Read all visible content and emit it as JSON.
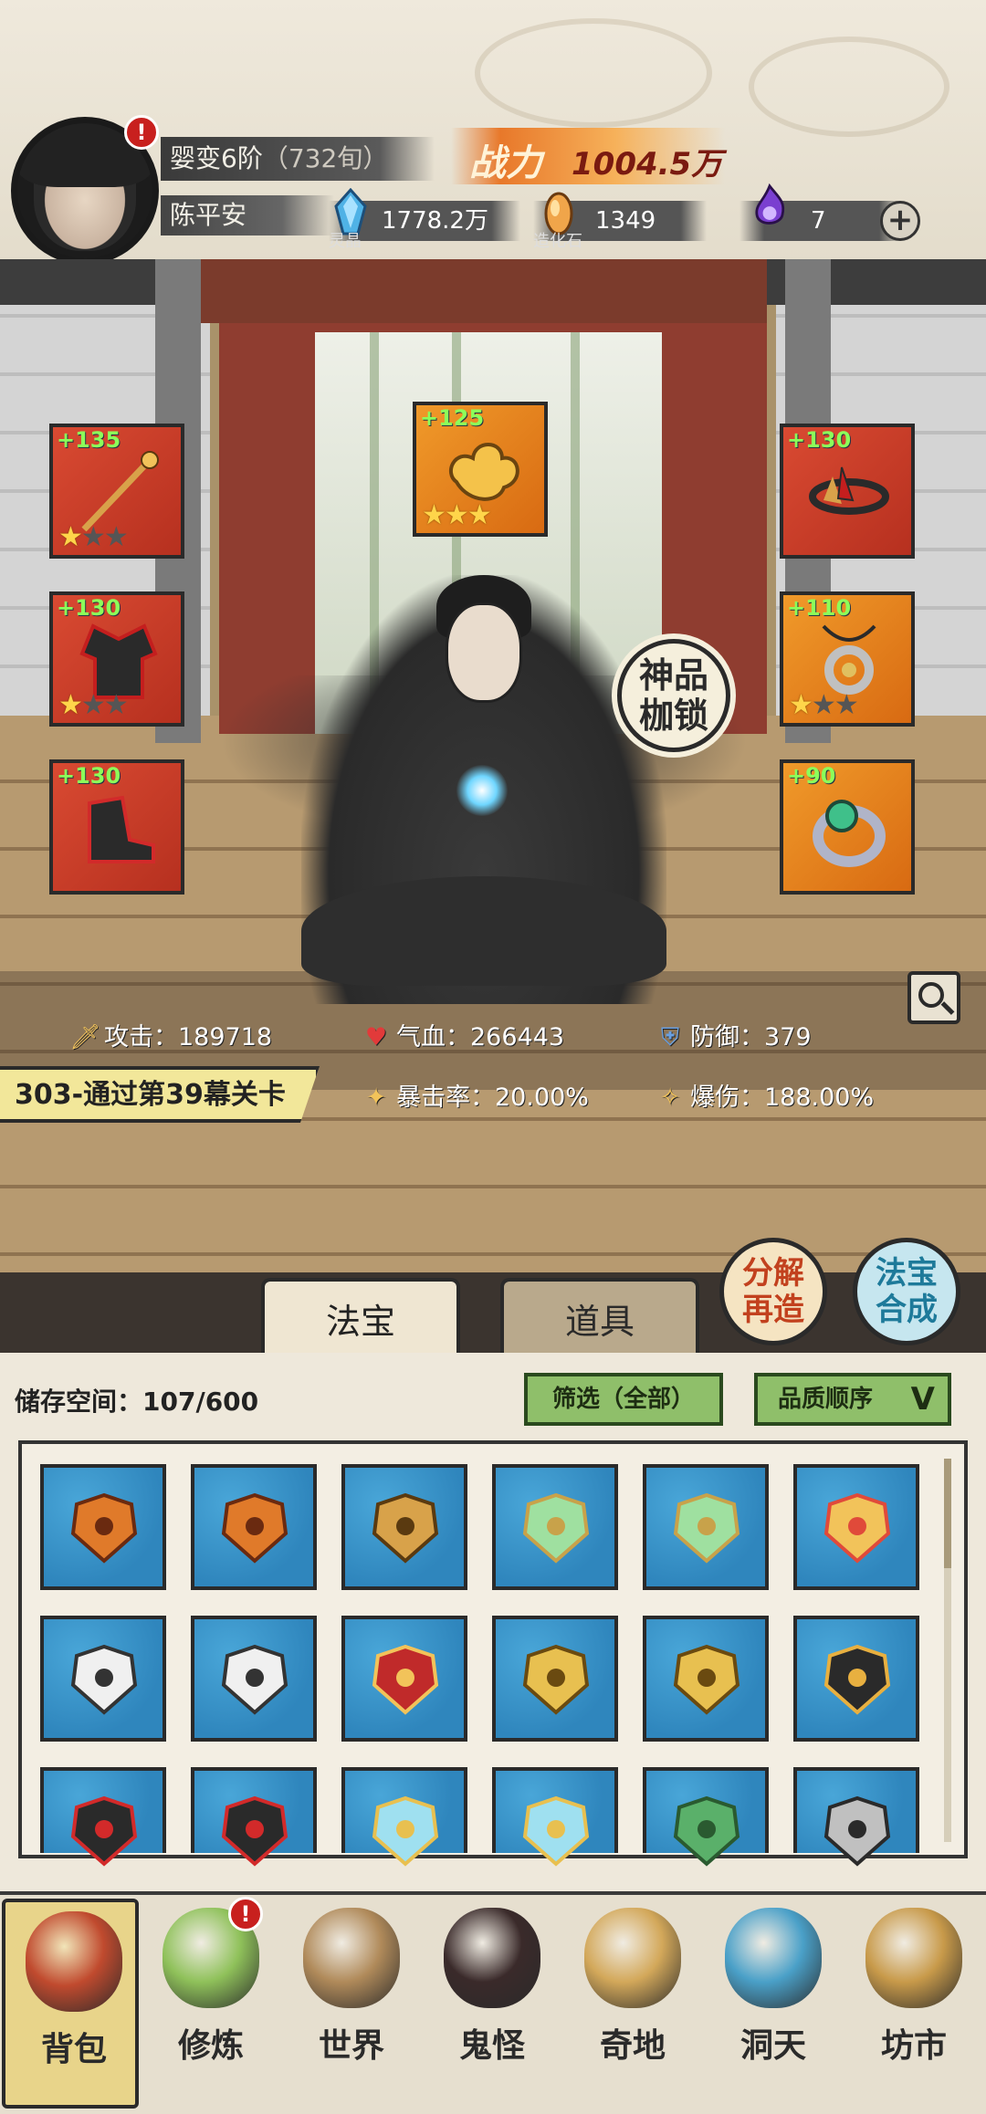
{
  "header": {
    "realm": "婴变6阶",
    "realm_sub": "（732旬）",
    "player_name": "陈平安",
    "power_label": "战力",
    "power_value": "1004.5万",
    "resources": [
      {
        "icon": "spirit-crystal-icon",
        "value": "1778.2万",
        "caption": "灵晶",
        "color": "#3fa0d8"
      },
      {
        "icon": "creation-stone-icon",
        "value": "1349",
        "caption": "造化石",
        "color": "#e0913c"
      },
      {
        "icon": "purple-flame-icon",
        "value": "7",
        "caption": "",
        "color": "#7a3fd0"
      }
    ],
    "plus_symbol": "+",
    "alert_symbol": "!"
  },
  "equipment": {
    "left": [
      {
        "level": "+135",
        "stars": 1,
        "icon": "staff-icon",
        "frame": "red"
      },
      {
        "level": "+130",
        "stars": 1,
        "icon": "robe-armor-icon",
        "frame": "red"
      },
      {
        "level": "+130",
        "stars": 0,
        "icon": "boots-icon",
        "frame": "red"
      }
    ],
    "top": {
      "level": "+125",
      "stars": 3,
      "icon": "cloud-talisman-icon",
      "frame": "gold"
    },
    "right": [
      {
        "level": "+130",
        "stars": 0,
        "icon": "crown-circlet-icon",
        "frame": "red"
      },
      {
        "level": "+110",
        "stars": 1,
        "icon": "pendant-icon",
        "frame": "gold"
      },
      {
        "level": "+90",
        "stars": 0,
        "icon": "jade-ring-icon",
        "frame": "gold"
      }
    ],
    "star_symbol": "★",
    "divine_badge": "神品\n枷锁"
  },
  "stats": {
    "attack_label": "攻击：",
    "attack_value": "189718",
    "hp_label": "气血：",
    "hp_value": "266443",
    "defense_label": "防御：",
    "defense_value": "379",
    "crit_label": "暴击率：",
    "crit_value": "20.00%",
    "critdmg_label": "爆伤：",
    "critdmg_value": "188.00%"
  },
  "quest": "303-通过第39幕关卡",
  "tabs": [
    {
      "label": "法宝",
      "active": true
    },
    {
      "label": "道具",
      "active": false
    }
  ],
  "actions": {
    "decompose": "分解\n再造",
    "synthesize": "法宝\n合成"
  },
  "inventory": {
    "storage_label": "储存空间：",
    "storage_value": "107/600",
    "filter_label": "筛选（全部）",
    "sort_label": "品质顺序",
    "sort_arrow": "V",
    "items": [
      "axe-icon",
      "axe-icon",
      "staff-icon",
      "fan-icon",
      "fan-icon",
      "golden-wings-icon",
      "white-robe-icon",
      "white-robe-icon",
      "red-armor-icon",
      "gold-armor-icon",
      "gold-armor-icon",
      "bracer-icon",
      "boots-icon",
      "boots-icon",
      "flame-crown-icon",
      "flame-crown-icon",
      "leaf-wreath-icon",
      "pendant-icon"
    ]
  },
  "nav": [
    {
      "label": "背包",
      "icon": "bag-icon",
      "active": true,
      "alert": false,
      "color": "#c04a2e"
    },
    {
      "label": "修炼",
      "icon": "lotus-icon",
      "active": false,
      "alert": true,
      "color": "#8fc15a"
    },
    {
      "label": "世界",
      "icon": "scroll-map-icon",
      "active": false,
      "alert": false,
      "color": "#b08a5a"
    },
    {
      "label": "鬼怪",
      "icon": "demon-egg-icon",
      "active": false,
      "alert": false,
      "color": "#3a2a2a"
    },
    {
      "label": "奇地",
      "icon": "floating-island-icon",
      "active": false,
      "alert": false,
      "color": "#d3a85a"
    },
    {
      "label": "洞天",
      "icon": "portal-icon",
      "active": false,
      "alert": false,
      "color": "#4aa0c8"
    },
    {
      "label": "坊市",
      "icon": "market-stall-icon",
      "active": false,
      "alert": false,
      "color": "#c89a4a"
    }
  ]
}
